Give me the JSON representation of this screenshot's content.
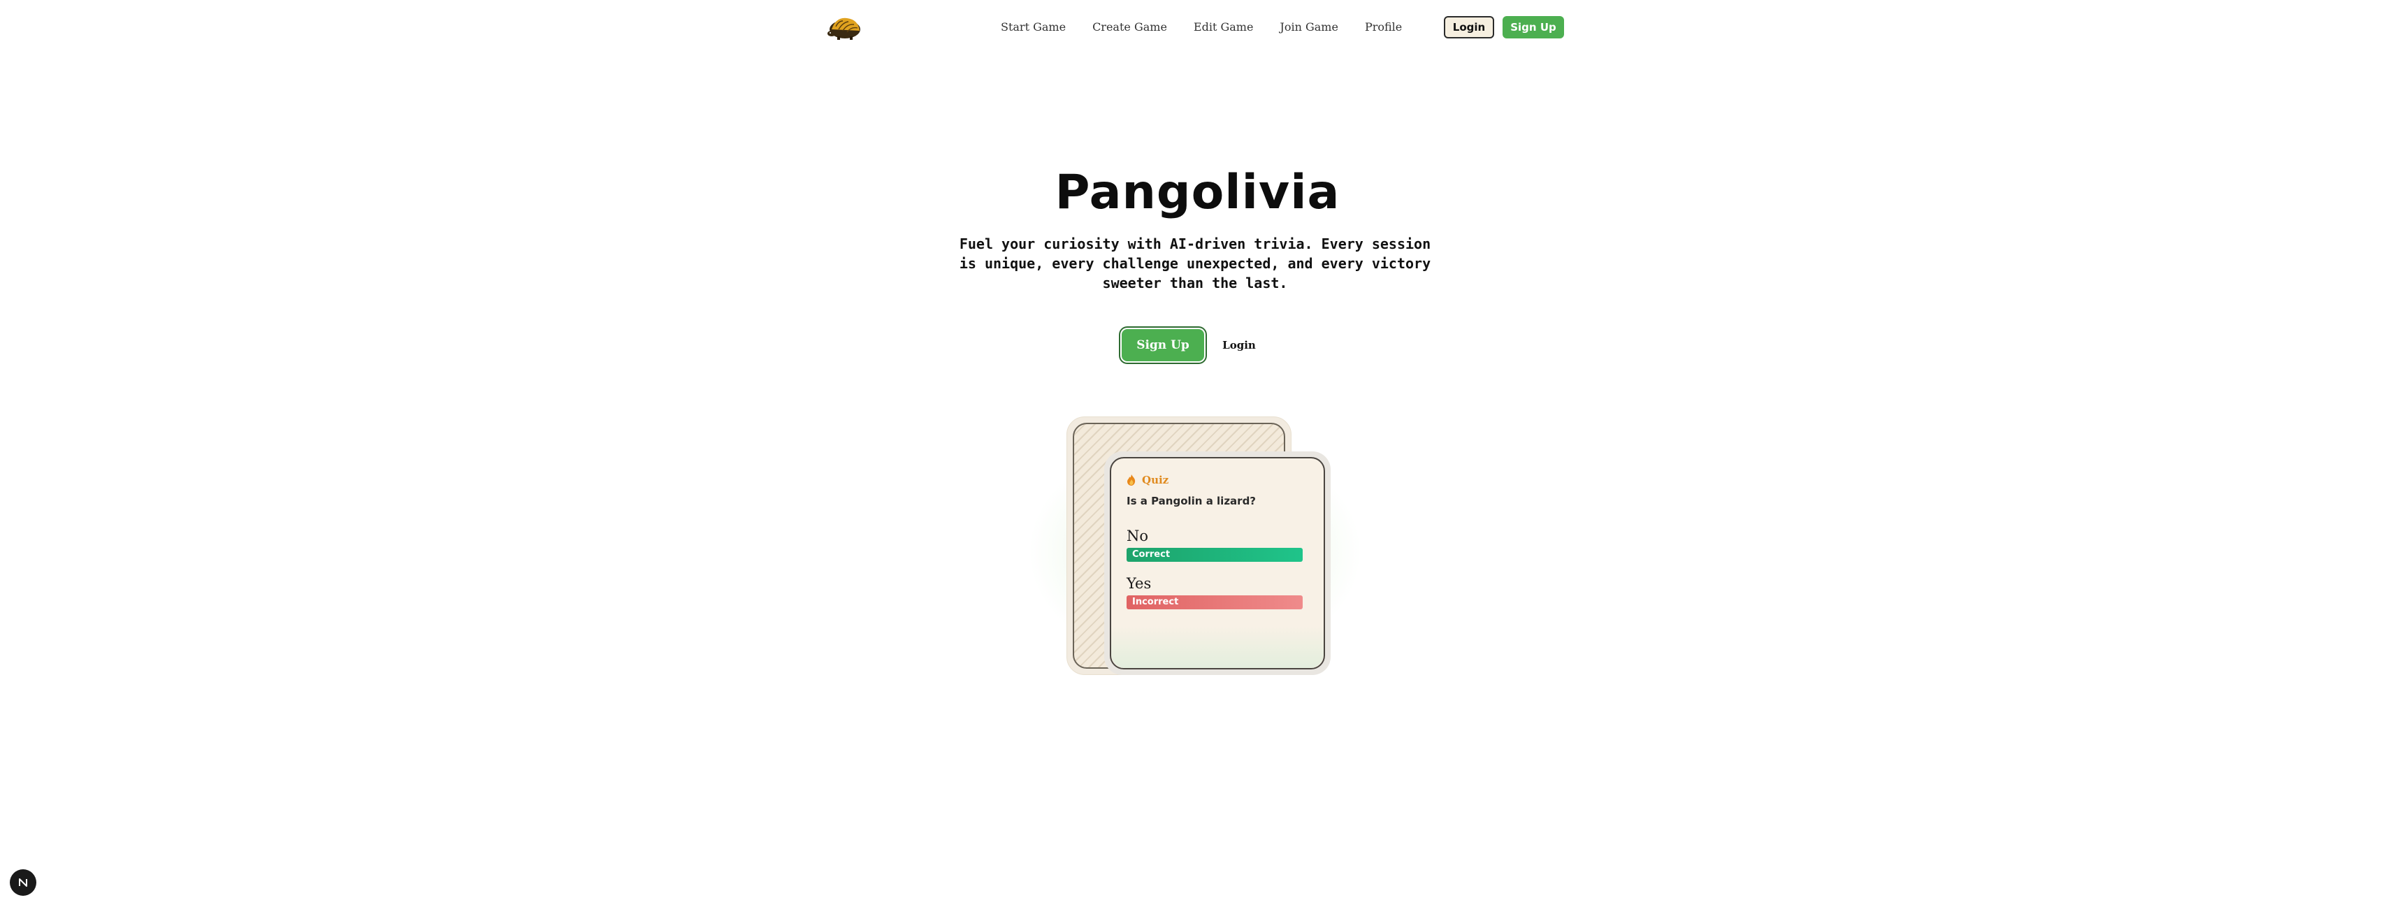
{
  "nav": {
    "links": {
      "start_game": "Start Game",
      "create_game": "Create Game",
      "edit_game": "Edit Game",
      "join_game": "Join Game",
      "profile": "Profile"
    },
    "login_label": "Login",
    "signup_label": "Sign Up"
  },
  "hero": {
    "title": "Pangolivia",
    "subtitle": "Fuel your curiosity with AI-driven trivia. Every session is unique, every challenge unexpected, and every victory sweeter than the last.",
    "signup_label": "Sign Up",
    "login_label": "Login"
  },
  "quiz_card": {
    "tag": "Quiz",
    "question": "Is a Pangolin a lizard?",
    "answers": [
      {
        "label": "No",
        "result": "Correct"
      },
      {
        "label": "Yes",
        "result": "Incorrect"
      }
    ]
  },
  "colors": {
    "accent_green": "#4caf50",
    "correct": "#1ea36b",
    "incorrect": "#e06363",
    "quiz_orange": "#e08a1e"
  }
}
